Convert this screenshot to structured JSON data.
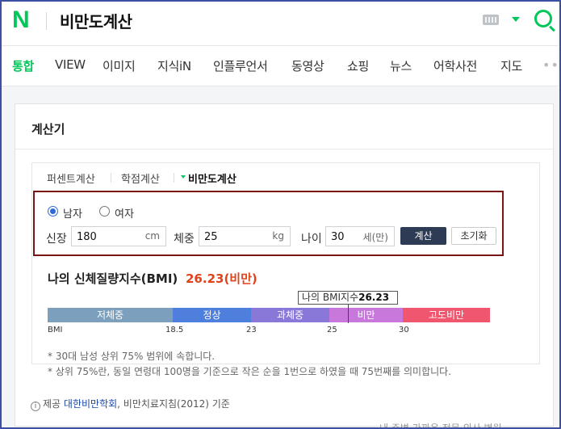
{
  "header": {
    "logo_letter": "N",
    "query": "비만도계산",
    "brand_color": "#03c75a"
  },
  "tabs": [
    {
      "label": "통합",
      "active": true
    },
    {
      "label": "VIEW"
    },
    {
      "label": "이미지"
    },
    {
      "label": "지식iN"
    },
    {
      "label": "인플루언서"
    },
    {
      "label": "동영상"
    },
    {
      "label": "쇼핑"
    },
    {
      "label": "뉴스"
    },
    {
      "label": "어학사전"
    },
    {
      "label": "지도"
    }
  ],
  "card": {
    "title": "계산기",
    "subtabs": [
      {
        "label": "퍼센트계산"
      },
      {
        "label": "학점계산"
      },
      {
        "label": "비만도계산",
        "active": true
      }
    ]
  },
  "form": {
    "gender_male": "남자",
    "gender_female": "여자",
    "selected_gender": "남자",
    "height_label": "신장",
    "height_value": "180",
    "height_unit": "cm",
    "weight_label": "체중",
    "weight_value": "25",
    "weight_unit": "kg",
    "age_label": "나이",
    "age_value": "30",
    "age_unit": "세(만)",
    "calc_button": "계산",
    "reset_button": "초기화"
  },
  "result": {
    "title": "나의 신체질량지수(BMI)",
    "value": "26.23(비만)",
    "marker_label": "나의 BMI지수",
    "marker_value": "26.23",
    "scale_label": "BMI",
    "categories": [
      {
        "label": "저체중",
        "color": "#7b9fbd"
      },
      {
        "label": "정상",
        "color": "#4f7fdc"
      },
      {
        "label": "과체중",
        "color": "#8a78d8"
      },
      {
        "label": "비만",
        "color": "#c878db"
      },
      {
        "label": "고도비만",
        "color": "#f0566e"
      }
    ],
    "ticks": [
      "18.5",
      "23",
      "25",
      "30"
    ],
    "notes": [
      "* 30대 남성 상위 75% 범위에 속합니다.",
      "* 상위 75%란, 동일 연령대 100명을 기준으로 작은 순을 1번으로 하였을 때 75번째를 의미합니다."
    ],
    "accent_color": "#e0421c"
  },
  "source": {
    "prefix": "제공",
    "link": "대한비만학회",
    "suffix": ", 비만치료지침(2012) 기준"
  },
  "footer_cut": "내 주변 가까운 전문 의사 병원"
}
